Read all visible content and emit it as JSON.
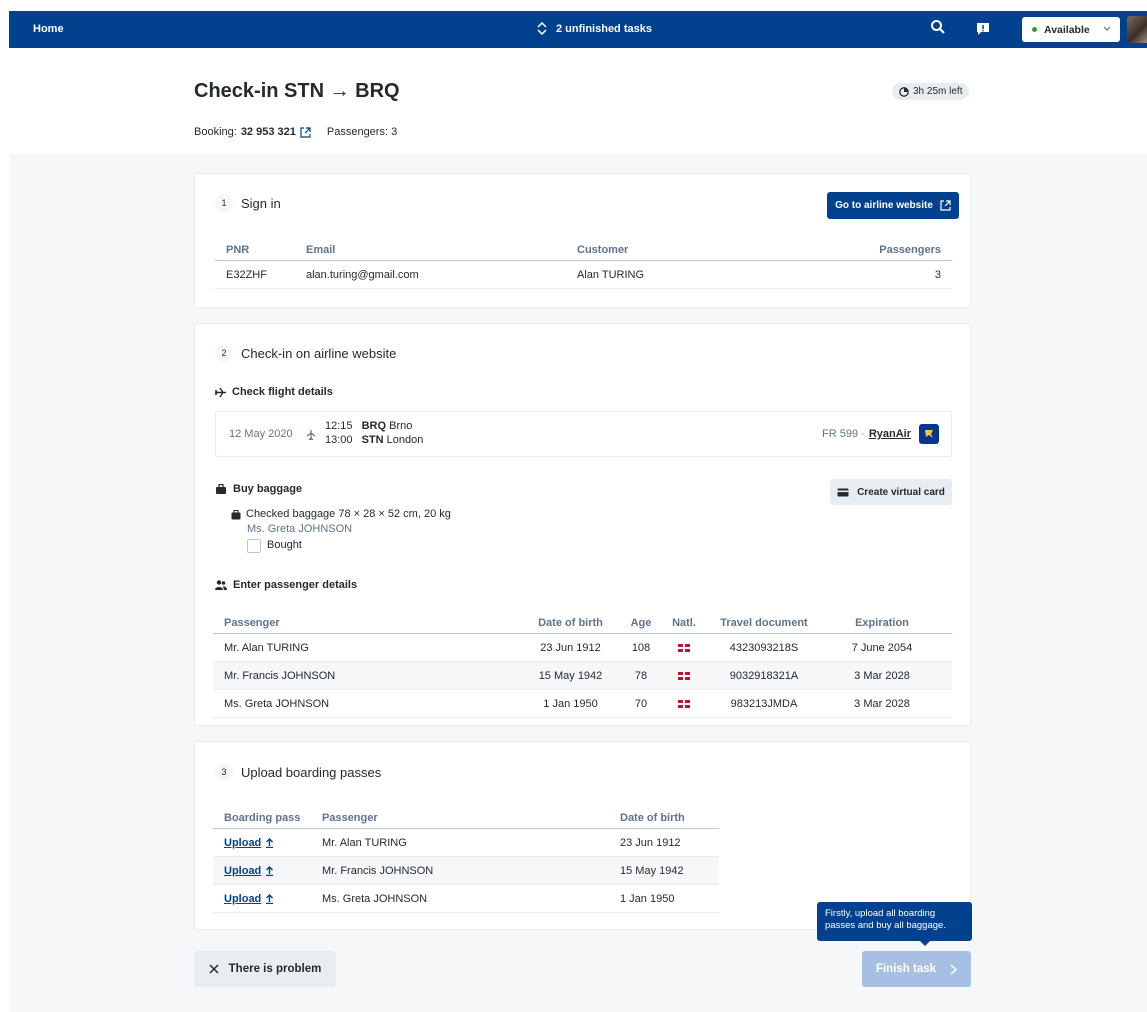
{
  "topbar": {
    "home": "Home",
    "tasks": "2 unfinished tasks",
    "status": "Available"
  },
  "header": {
    "title": "Check-in STN → BRQ",
    "time_left": "3h 25m left",
    "booking_label": "Booking:",
    "booking_number": "32 953 321",
    "passengers_label": "Passengers: 3"
  },
  "sign_in": {
    "number": "1",
    "title": "Sign in",
    "airline_button": "Go to airline website",
    "columns": [
      "PNR",
      "Email",
      "Customer",
      "Passengers"
    ],
    "row": [
      "E32ZHF",
      "alan.turing@gmail.com",
      "Alan TURING",
      "3"
    ]
  },
  "checkin": {
    "number": "2",
    "title": "Check-in on airline website",
    "flight_details_title": "Check flight details",
    "flight": {
      "date": "12 May 2020",
      "dep_time": "12:15",
      "dep_code": "BRQ",
      "dep_city": "Brno",
      "arr_time": "13:00",
      "arr_code": "STN",
      "arr_city": "London",
      "flight_no": "FR 599 ·",
      "airline": "RyanAir"
    },
    "baggage_title": "Buy baggage",
    "virtual_card_button": "Create virtual card",
    "baggage_item": "Checked baggage 78 × 28 × 52 cm, 20 kg",
    "baggage_passenger": "Ms. Greta JOHNSON",
    "bought_label": "Bought",
    "passenger_details_title": "Enter passenger details",
    "columns": [
      "Passenger",
      "Date of birth",
      "Age",
      "Natl.",
      "Travel document",
      "Expiration"
    ],
    "rows": [
      [
        "Mr. Alan TURING",
        "23 Jun 1912",
        "108",
        "4323093218S",
        "7 June 2054"
      ],
      [
        "Mr. Francis JOHNSON",
        "15 May 1942",
        "78",
        "9032918321A",
        "3 Mar 2028"
      ],
      [
        "Ms. Greta JOHNSON",
        "1 Jan 1950",
        "70",
        "983213JMDA",
        "3 Mar 2028"
      ]
    ]
  },
  "upload": {
    "number": "3",
    "title": "Upload boarding passes",
    "columns": [
      "Boarding pass",
      "Passenger",
      "Date of birth"
    ],
    "upload_label": "Upload",
    "rows": [
      [
        "Mr. Alan TURING",
        "23 Jun 1912"
      ],
      [
        "Mr. Francis JOHNSON",
        "15 May 1942"
      ],
      [
        "Ms. Greta JOHNSON",
        "1 Jan 1950"
      ]
    ]
  },
  "footer": {
    "problem_button": "There is problem",
    "finish_button": "Finish task",
    "tooltip": "Firstly, upload all boarding passes and buy all baggage."
  },
  "colors": {
    "primary": "#01418e",
    "disabled_primary": "#a7bfe3",
    "background": "#f5f7f9",
    "available": "#28a138"
  }
}
